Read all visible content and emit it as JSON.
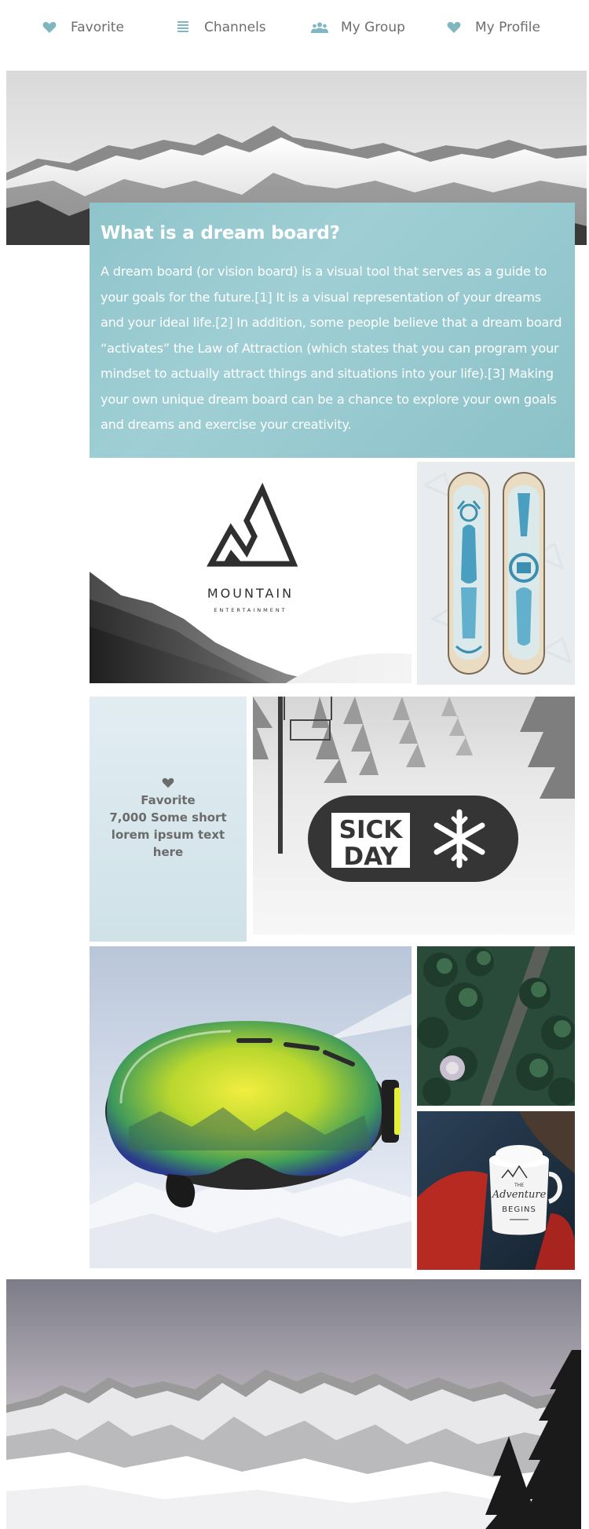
{
  "nav": {
    "items": [
      {
        "label": "Favorite",
        "icon": "heart-icon"
      },
      {
        "label": "Channels",
        "icon": "list-icon"
      },
      {
        "label": "My Group",
        "icon": "group-icon"
      },
      {
        "label": "My Profile",
        "icon": "heart-icon"
      }
    ]
  },
  "info": {
    "title": "What is a dream board?",
    "body": "A dream board (or vision board) is a visual tool that serves as a guide to your goals for the future.[1] It is a visual representation of your dreams and your ideal life.[2] In addition, some people believe that a dream board “activates” the Law of Attraction (which states that you can program your mindset to actually attract things and situations into your life).[3] Making your own unique dream board can be a chance to explore your own goals and dreams and exercise your creativity."
  },
  "mountain_logo": {
    "name": "MOUNTAIN",
    "tagline": "ENTERTAINMENT"
  },
  "favorite_card": {
    "title": "Favorite",
    "text": "7,000 Some short lorem ipsum text here",
    "icon": "heart-icon"
  },
  "sick_day": {
    "line1": "SICK",
    "line2": "DAY",
    "icon": "snowflake-icon"
  },
  "mug": {
    "line1": "THE",
    "line2": "Adventure",
    "line3": "BEGINS"
  },
  "colors": {
    "accent": "#7fb6c0",
    "info_bg": "#95c9cf",
    "nav_text": "#6d6d6d",
    "dark_logo": "#2f2f2f"
  }
}
